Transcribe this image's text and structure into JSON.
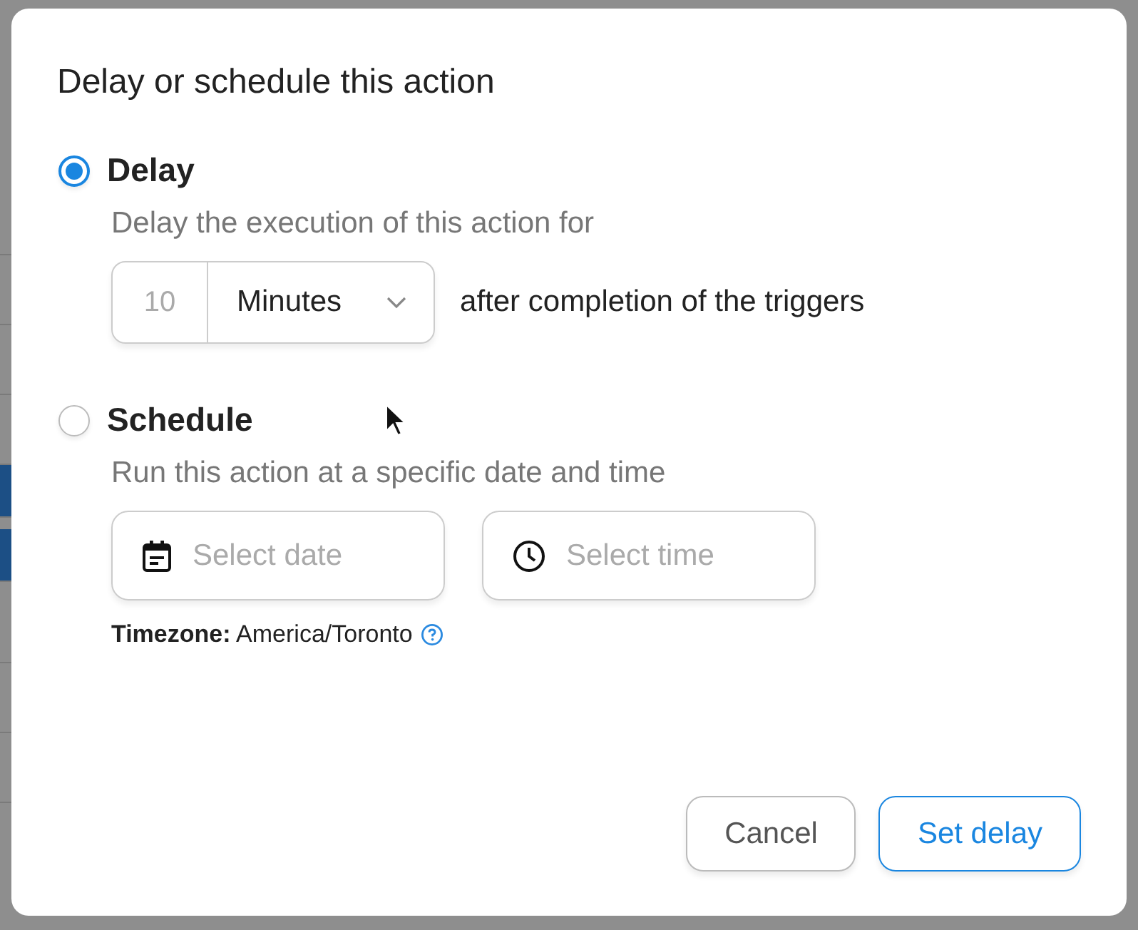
{
  "dialog": {
    "title": "Delay or schedule this action",
    "options": [
      {
        "kind": "delay",
        "label": "Delay",
        "selected": true,
        "description": "Delay the execution of this action for",
        "amount": {
          "value": "10"
        },
        "unit": {
          "value": "Minutes"
        },
        "suffix": "after completion of the triggers"
      },
      {
        "kind": "schedule",
        "label": "Schedule",
        "selected": false,
        "description": "Run this action at a specific date and time",
        "date": {
          "placeholder": "Select date"
        },
        "time": {
          "placeholder": "Select time"
        },
        "timezone": "**Timezone:** America/Toronto"
      }
    ],
    "buttons": [
      {
        "label": "Cancel",
        "kind": "secondary"
      },
      {
        "label": "Set delay",
        "kind": "primary"
      }
    ]
  }
}
